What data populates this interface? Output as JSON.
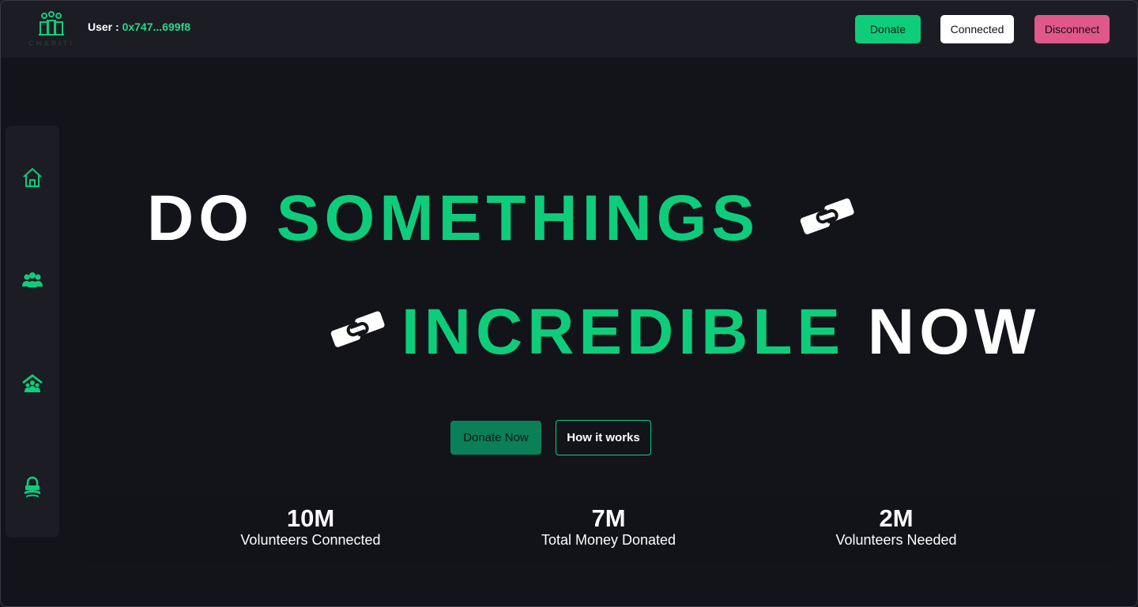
{
  "header": {
    "logo_text": "CHARITI",
    "user_label": "User : ",
    "user_address": "0x747...699f8",
    "donate_label": "Donate",
    "connected_label": "Connected",
    "disconnect_label": "Disconnect"
  },
  "sidebar": {
    "items": [
      {
        "icon": "home-icon"
      },
      {
        "icon": "users-icon"
      },
      {
        "icon": "charity-house-icon"
      },
      {
        "icon": "lock-icon"
      }
    ]
  },
  "hero": {
    "line1_white": "DO ",
    "line1_green": "SOMETHINGS",
    "line2_green": "INCREDIBLE",
    "line2_white": " NOW",
    "donate_now_label": "Donate Now",
    "how_it_works_label": "How it works"
  },
  "stats": [
    {
      "value": "10M",
      "label": "Volunteers Connected"
    },
    {
      "value": "7M",
      "label": "Total Money Donated"
    },
    {
      "value": "2M",
      "label": "Volunteers Needed"
    }
  ],
  "colors": {
    "accent": "#0dcd7b",
    "disconnect": "#e0588a",
    "background": "#13131a",
    "panel": "#1c1c24"
  }
}
